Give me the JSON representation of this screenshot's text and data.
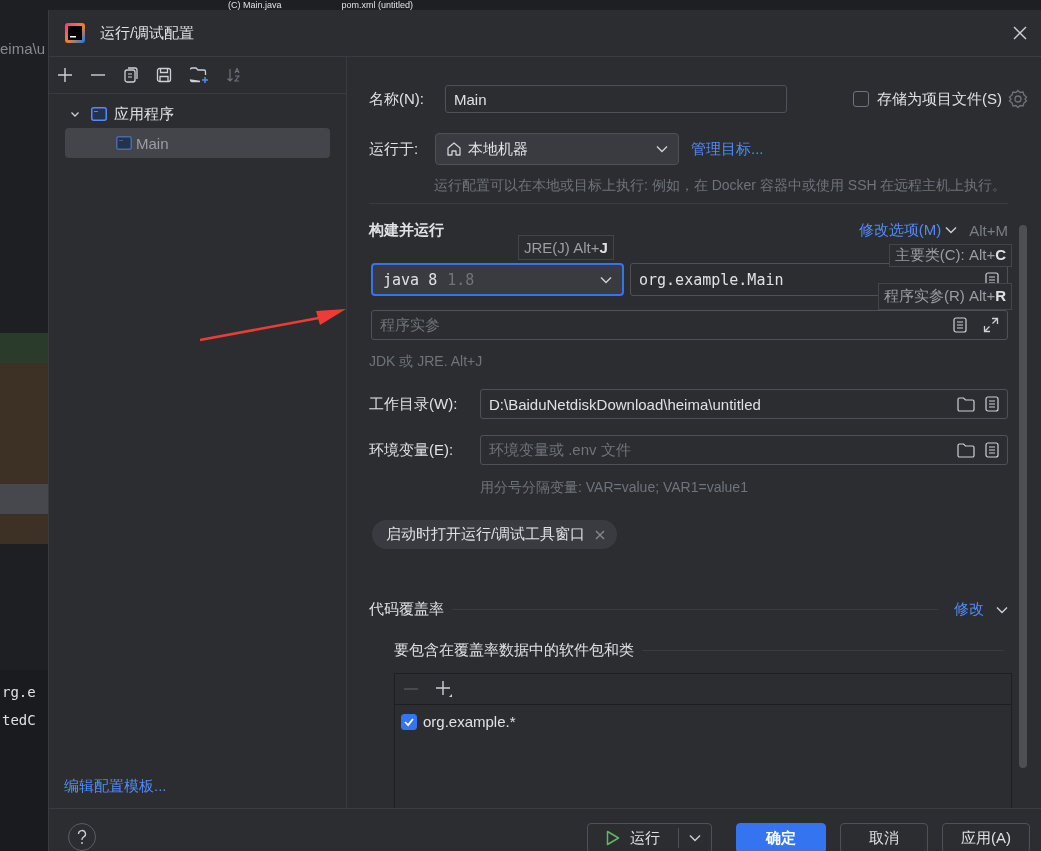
{
  "background_editor": {
    "tabs": [
      {
        "label": "(C) Main.java"
      },
      {
        "label": "pom.xml (untitled)"
      }
    ],
    "path_text": "eima\\u",
    "code_lines": [
      "rg.e",
      "tedC"
    ]
  },
  "window": {
    "title": "运行/调试配置"
  },
  "sidebar": {
    "tree": [
      {
        "label": "应用程序",
        "expanded": true,
        "children": [
          {
            "label": "Main",
            "selected": true
          }
        ]
      }
    ],
    "footer_link": "编辑配置模板..."
  },
  "form": {
    "name": {
      "label": "名称(N):",
      "value": "Main"
    },
    "store_as_project_file": {
      "label": "存储为项目文件(S)",
      "checked": false
    },
    "run_on": {
      "label": "运行于:",
      "value": "本地机器",
      "link": "管理目标...",
      "hint": "运行配置可以在本地或目标上执行: 例如，在 Docker 容器中或使用 SSH 在远程主机上执行。"
    },
    "build_run": {
      "title": "构建并运行",
      "modify_link": "修改选项(M)",
      "modify_shortcut": "Alt+M",
      "jre": {
        "value": "java 8",
        "version": "1.8",
        "focused": true,
        "tooltip": "JRE(J) Alt+**J**"
      },
      "main_class": {
        "value": "org.example.Main",
        "tooltip": "主要类(C): Alt+**C**"
      },
      "program_args": {
        "placeholder": "程序实参",
        "tooltip": "程序实参(R) Alt+**R**"
      },
      "hint": "JDK 或 JRE. Alt+J"
    },
    "working_dir": {
      "label": "工作目录(W):",
      "value": "D:\\BaiduNetdiskDownload\\heima\\untitled"
    },
    "env_vars": {
      "label": "环境变量(E):",
      "placeholder": "环境变量或 .env 文件",
      "hint": "用分号分隔变量: VAR=value; VAR1=value1"
    },
    "chips": [
      {
        "label": "启动时打开运行/调试工具窗口"
      }
    ],
    "coverage": {
      "title": "代码覆盖率",
      "modify_link": "修改",
      "packages_title": "要包含在覆盖率数据中的软件包和类",
      "entries": [
        {
          "label": "org.example.*",
          "checked": true
        }
      ]
    }
  },
  "buttons": [
    {
      "label": "运行",
      "kind": "split"
    },
    {
      "label": "确定",
      "kind": "primary"
    },
    {
      "label": "取消",
      "kind": "default"
    },
    {
      "label": "应用(A)",
      "kind": "default"
    }
  ]
}
